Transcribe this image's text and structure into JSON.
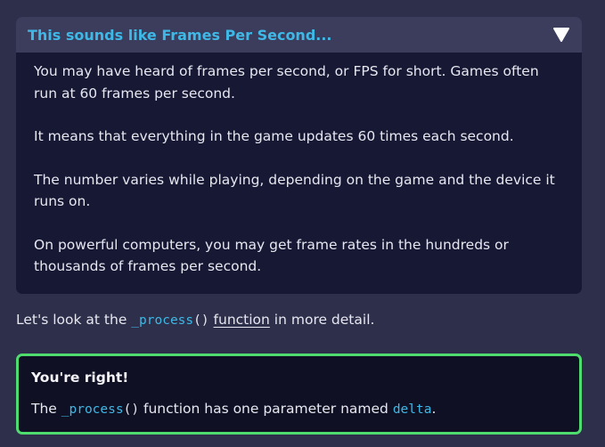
{
  "callout": {
    "title": "This sounds like Frames Per Second...",
    "toggle_icon": "chevron-down-icon",
    "paragraphs": [
      "You may have heard of frames per second, or FPS for short. Games often run at 60 frames per second.",
      "It means that everything in the game updates 60 times each second.",
      "The number varies while playing, depending on the game and the device it runs on.",
      "On powerful computers, you may get frame rates in the hundreds or thousands of frames per second."
    ]
  },
  "intro": {
    "prefix": "Let's look at the ",
    "code_name": "_process",
    "code_parens": "()",
    "link_text": "function",
    "suffix": " in more detail."
  },
  "feedback": {
    "title": "You're right!",
    "text_prefix": "The ",
    "code_name": "_process",
    "code_parens": "()",
    "text_middle": " function has one parameter named ",
    "param_name": "delta",
    "text_suffix": "."
  },
  "colors": {
    "background": "#2e2f4a",
    "callout_header": "#3c3d5c",
    "callout_body": "#171834",
    "accent_blue": "#3fb8e6",
    "success_border": "#4fdc6e"
  }
}
